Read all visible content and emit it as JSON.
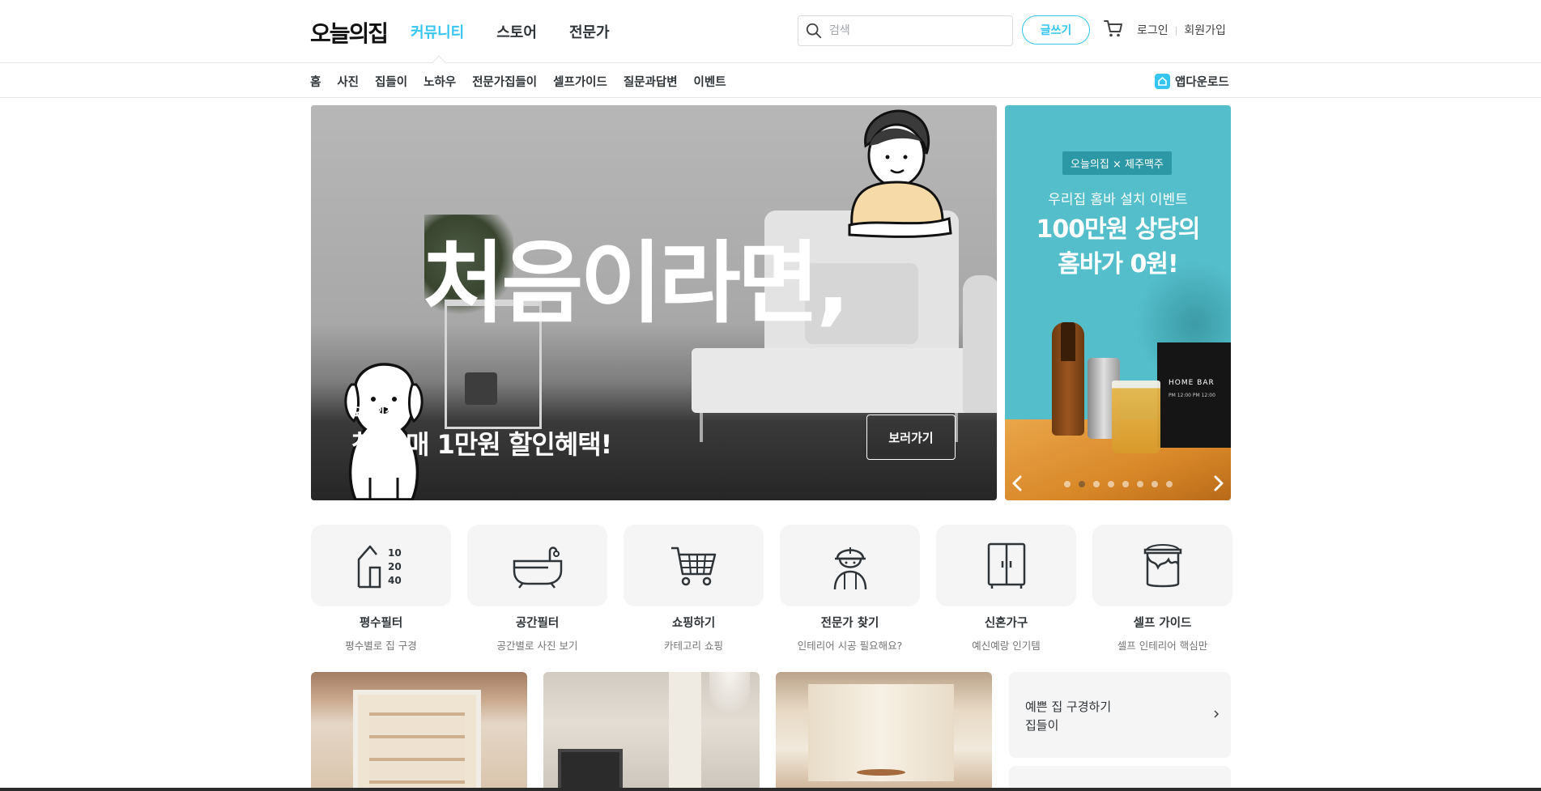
{
  "header": {
    "logo": "오늘의집",
    "nav": [
      {
        "label": "커뮤니티",
        "active": true
      },
      {
        "label": "스토어",
        "active": false
      },
      {
        "label": "전문가",
        "active": false
      }
    ],
    "search_placeholder": "검색",
    "write_button": "글쓰기",
    "login": "로그인",
    "signup": "회원가입",
    "cart_icon": "cart-icon",
    "search_icon": "search-icon"
  },
  "subnav": {
    "items": [
      "홈",
      "사진",
      "집들이",
      "노하우",
      "전문가집들이",
      "셀프가이드",
      "질문과답변",
      "이벤트"
    ],
    "app_download": "앱다운로드"
  },
  "hero": {
    "headline": "처음이라면,",
    "brand": "오늘의집",
    "subtitle": "첫 구매 1만원 할인혜택!",
    "button": "보러가기"
  },
  "side_banner": {
    "tag": "오늘의집 × 제주맥주",
    "subtitle": "우리집 홈바 설치 이벤트",
    "title_line1": "100만원 상당의",
    "title_line2": "홈바가 0원!",
    "homebar_label": "HOME BAR",
    "homebar_hours": "PM 12:00   PM 12:00",
    "dot_count": 8,
    "active_dot": 2
  },
  "categories": [
    {
      "icon": "house-size-icon",
      "label": "평수필터",
      "desc": "평수별로 집 구경"
    },
    {
      "icon": "bathtub-icon",
      "label": "공간필터",
      "desc": "공간별로 사진 보기"
    },
    {
      "icon": "shopping-cart-icon",
      "label": "쇼핑하기",
      "desc": "카테고리 쇼핑"
    },
    {
      "icon": "worker-icon",
      "label": "전문가 찾기",
      "desc": "인테리어 시공 필요해요?"
    },
    {
      "icon": "wardrobe-icon",
      "label": "신혼가구",
      "desc": "예신예랑 인기템"
    },
    {
      "icon": "paint-bucket-icon",
      "label": "셀프 가이드",
      "desc": "셀프 인테리어 핵심만"
    }
  ],
  "house_size_icon_numbers": [
    "10",
    "20",
    "40"
  ],
  "side_card": {
    "line1": "예쁜 집 구경하기",
    "line2": "집들이"
  },
  "colors": {
    "accent": "#35c5f0",
    "text": "#2f3438",
    "side_banner_bg": "#54bfcb"
  }
}
